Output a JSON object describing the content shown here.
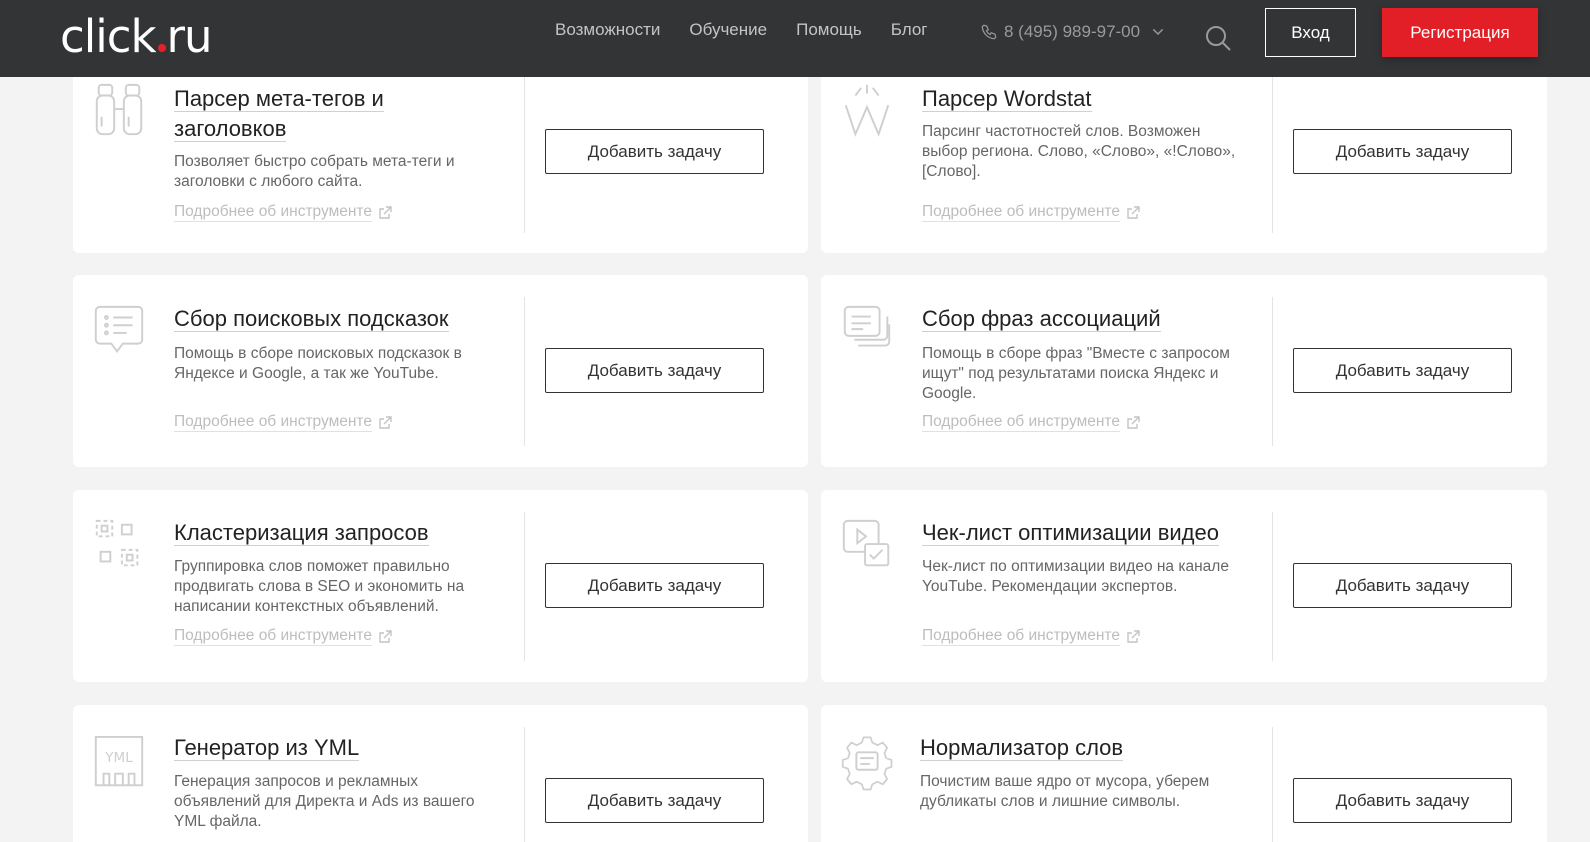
{
  "header": {
    "logo_left": "click",
    "logo_right": "ru",
    "nav": [
      "Возможности",
      "Обучение",
      "Помощь",
      "Блог"
    ],
    "phone": "8 (495) 989-97-00",
    "login": "Вход",
    "register": "Регистрация"
  },
  "more_label": "Подробнее об инструменте",
  "add_label": "Добавить задачу",
  "cards": [
    {
      "title_line1": "Парсер мета-тегов и",
      "title_line2": "заголовков",
      "desc": "Позволяет быстро собрать мета-теги и заголовки с любого сайта.",
      "icon": "binoculars-icon"
    },
    {
      "title_line1": "Парсер Wordstat",
      "title_line2": "",
      "desc": "Парсинг частотностей слов. Возможен выбор региона. Слово, «Слово», «!Слово», [Слово].",
      "icon": "wordstat-icon"
    },
    {
      "title_line1": "Сбор поисковых подсказок",
      "title_line2": "",
      "desc": "Помощь в сборе поисковых подсказок в Яндексе и Google, а так же YouTube.",
      "icon": "chat-list-icon"
    },
    {
      "title_line1": "Сбор фраз ассоциаций",
      "title_line2": "",
      "desc": "Помощь в сборе фраз \"Вместе с запросом ищут\" под результатами поиска Яндекс и Google.",
      "icon": "stacked-docs-icon"
    },
    {
      "title_line1": "Кластеризация запросов",
      "title_line2": "",
      "desc": "Группировка слов поможет правильно продвигать слова в SEO и экономить на написании контекстных объявлений.",
      "icon": "cluster-icon"
    },
    {
      "title_line1": "Чек-лист оптимизации видео",
      "title_line2": "",
      "desc": "Чек-лист по оптимизации видео на канале YouTube. Рекомендации экспертов.",
      "icon": "video-check-icon"
    },
    {
      "title_line1": "Генератор из YML",
      "title_line2": "",
      "desc": "Генерация запросов и рекламных объявлений для Директа и Ads из вашего YML файла.",
      "icon": "yml-icon"
    },
    {
      "title_line1": "Нормализатор слов",
      "title_line2": "",
      "desc": "Почистим ваше ядро от мусора, уберем дубликаты слов и лишние символы.",
      "icon": "gear-doc-icon"
    }
  ]
}
